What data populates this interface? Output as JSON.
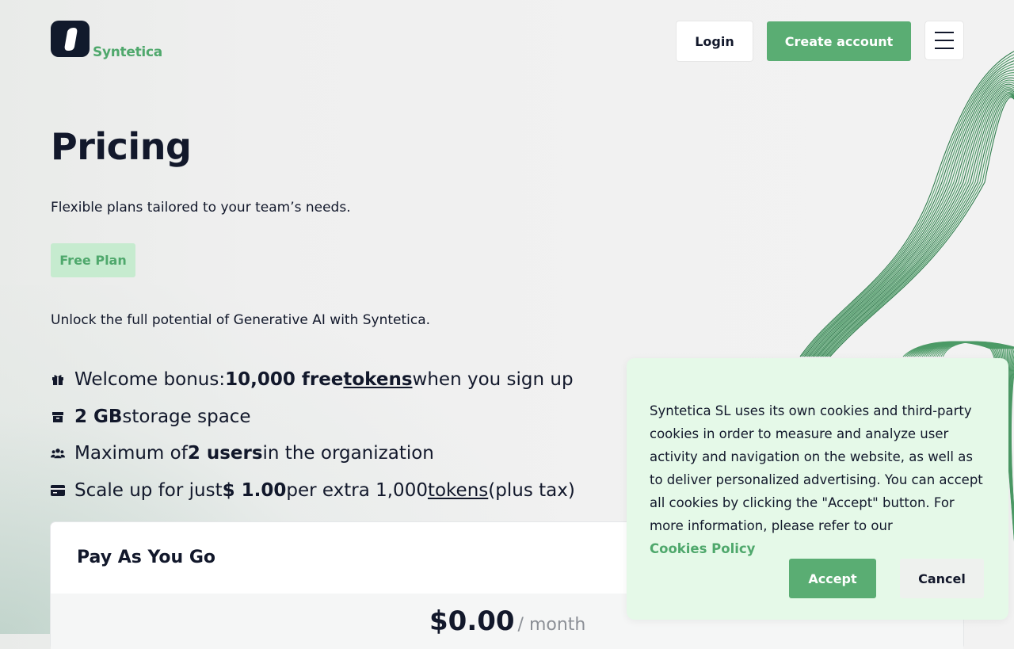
{
  "brand": {
    "name": "Syntetica"
  },
  "nav": {
    "login_label": "Login",
    "create_account_label": "Create account",
    "menu_icon": "hamburger-icon"
  },
  "hero": {
    "title": "Pricing",
    "subtitle": "Flexible plans tailored to your team’s needs.",
    "plan_badge": "Free Plan",
    "unlock_text": "Unlock the full potential of Generative AI with Syntetica."
  },
  "features": [
    {
      "icon": "gift-icon",
      "t1": "Welcome bonus: ",
      "b1": "10,000 free ",
      "link": "tokens",
      "t2": " when you sign up"
    },
    {
      "icon": "archive-box-icon",
      "b1": "2 GB",
      "t1": " storage space"
    },
    {
      "icon": "users-icon",
      "t1": "Maximum of ",
      "b1": "2 users",
      "t2": " in the organization"
    },
    {
      "icon": "credit-card-icon",
      "t1": "Scale up for just ",
      "b1": "$ 1.00",
      "t2": " per extra 1,000 ",
      "link": "tokens",
      "t3": " (plus tax)"
    }
  ],
  "plan_card": {
    "title": "Pay As You Go",
    "price": "$0.00",
    "price_unit": "/ month"
  },
  "cookie_banner": {
    "text": "Syntetica SL uses its own cookies and third-party cookies in order to measure and analyze user activity and navigation on the website, as well as to deliver personalized advertising. You can accept all cookies by clicking the \"Accept\" button. For more information, please refer to our",
    "policy_link": "Cookies Policy",
    "accept_label": "Accept",
    "cancel_label": "Cancel"
  },
  "colors": {
    "accent_green": "#5aad73",
    "brand_text_green": "#4fa86c",
    "dark_navy": "#12182b",
    "badge_bg": "#c6ebcf",
    "cookie_bg": "#e5f9e8"
  }
}
